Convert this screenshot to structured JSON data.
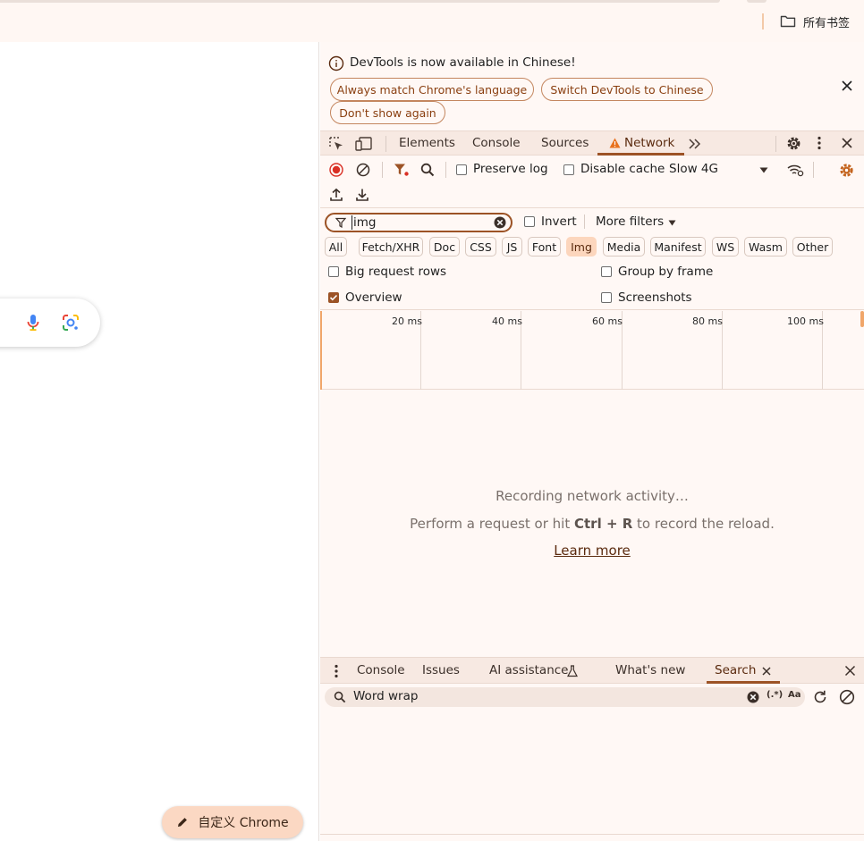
{
  "browser": {
    "bookmarks_label": "所有书签",
    "customize_label": "自定义 Chrome"
  },
  "infobar": {
    "message": "DevTools is now available in Chinese!",
    "btn_match": "Always match Chrome's language",
    "btn_switch": "Switch DevTools to Chinese",
    "btn_dont_show": "Don't show again"
  },
  "tabs": {
    "elements": "Elements",
    "console": "Console",
    "sources": "Sources",
    "network": "Network"
  },
  "toolbar": {
    "preserve_log": "Preserve log",
    "disable_cache": "Disable cache",
    "throttling": "Slow 4G"
  },
  "filter": {
    "value": "img",
    "invert": "Invert",
    "more_filters": "More filters"
  },
  "types": [
    "All",
    "Fetch/XHR",
    "Doc",
    "CSS",
    "JS",
    "Font",
    "Img",
    "Media",
    "Manifest",
    "WS",
    "Wasm",
    "Other"
  ],
  "active_type": "Img",
  "options": {
    "big_rows": "Big request rows",
    "group_by_frame": "Group by frame",
    "overview": "Overview",
    "screenshots": "Screenshots"
  },
  "timeline": {
    "ticks": [
      "20 ms",
      "40 ms",
      "60 ms",
      "80 ms",
      "100 ms"
    ]
  },
  "empty": {
    "line1": "Recording network activity…",
    "line2_pre": "Perform a request or hit ",
    "line2_key": "Ctrl + R",
    "line2_post": " to record the reload.",
    "learn_more": "Learn more"
  },
  "drawer": {
    "console": "Console",
    "issues": "Issues",
    "ai": "AI assistance",
    "whats_new": "What's new",
    "search": "Search",
    "search_value": "Word wrap",
    "regex_label": "(.*)",
    "case_label": "Aa"
  },
  "colors": {
    "accent": "#9c5326",
    "panel_bg": "#fff8f5",
    "tab_bg": "#f7e9e2",
    "warning": "#e8711d",
    "record_red": "#d93025"
  }
}
